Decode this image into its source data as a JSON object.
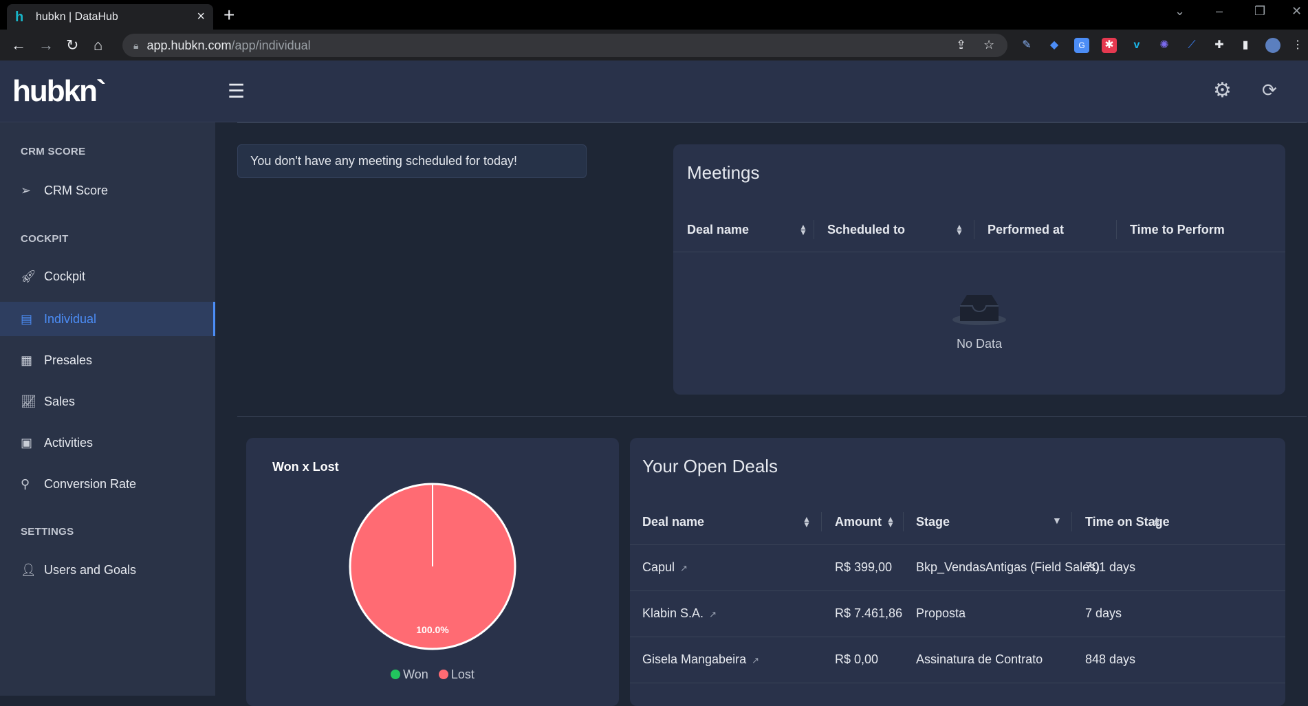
{
  "browser": {
    "tab_title": "hubkn | DataHub",
    "url_host": "app.hubkn.com",
    "url_path": "/app/individual"
  },
  "app": {
    "logo": "hubkn`"
  },
  "sidebar": {
    "sections": [
      {
        "title": "CRM SCORE",
        "items": [
          {
            "label": "CRM Score",
            "icon": "send-icon"
          }
        ]
      },
      {
        "title": "COCKPIT",
        "items": [
          {
            "label": "Cockpit",
            "icon": "rocket-icon"
          },
          {
            "label": "Individual",
            "icon": "document-user-icon",
            "active": true
          },
          {
            "label": "Presales",
            "icon": "calendar-a-icon"
          },
          {
            "label": "Sales",
            "icon": "line-chart-icon"
          },
          {
            "label": "Activities",
            "icon": "calendar-check-icon"
          },
          {
            "label": "Conversion Rate",
            "icon": "key-search-icon"
          }
        ]
      },
      {
        "title": "SETTINGS",
        "items": [
          {
            "label": "Users and Goals",
            "icon": "users-icon"
          }
        ]
      }
    ]
  },
  "main": {
    "alert": "You don't have any meeting scheduled for today!",
    "meetings": {
      "title": "Meetings",
      "columns": [
        "Deal name",
        "Scheduled to",
        "Performed at",
        "Time to Perform"
      ],
      "empty_text": "No Data"
    },
    "won_lost": {
      "title": "Won x Lost",
      "legend": [
        "Won",
        "Lost"
      ],
      "slice_label": "100.0%"
    },
    "open_deals": {
      "title": "Your Open Deals",
      "columns": [
        "Deal name",
        "Amount",
        "Stage",
        "Time on Stage"
      ],
      "rows": [
        {
          "deal": "Capul",
          "amount": "R$ 399,00",
          "stage": "Bkp_VendasAntigas (Field Sales)",
          "time": "701 days"
        },
        {
          "deal": "Klabin S.A.",
          "amount": "R$ 7.461,86",
          "stage": "Proposta",
          "time": "7 days"
        },
        {
          "deal": "Gisela Mangabeira",
          "amount": "R$ 0,00",
          "stage": "Assinatura de Contrato",
          "time": "848 days"
        }
      ]
    }
  },
  "chart_data": {
    "type": "pie",
    "title": "Won x Lost",
    "categories": [
      "Won",
      "Lost"
    ],
    "values": [
      0,
      100
    ],
    "colors": [
      "#22c55e",
      "#ff6b73"
    ],
    "legend": "bottom"
  }
}
